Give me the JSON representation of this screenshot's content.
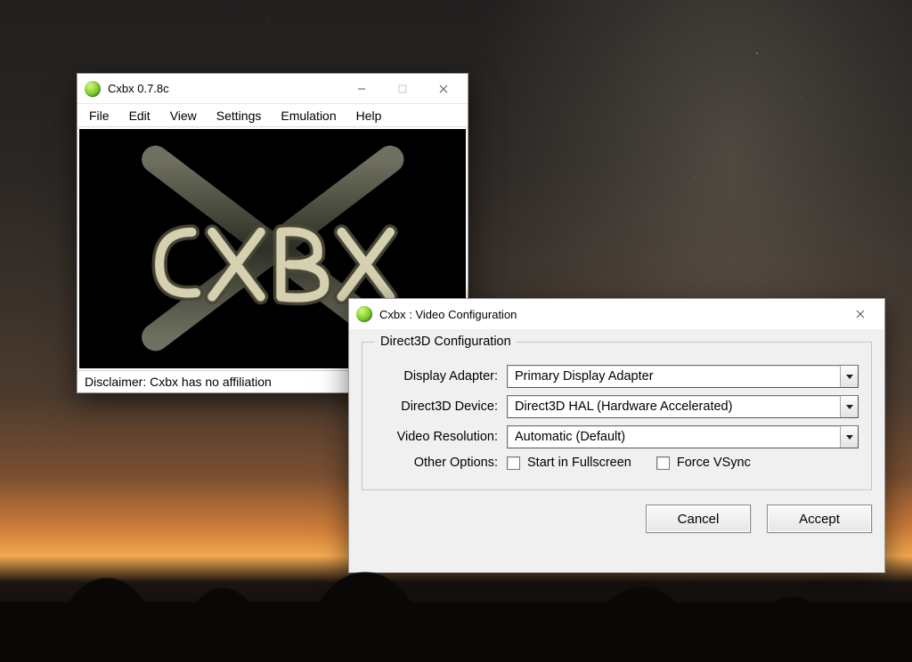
{
  "main_window": {
    "title": "Cxbx 0.7.8c",
    "menu": {
      "file": "File",
      "edit": "Edit",
      "view": "View",
      "settings": "Settings",
      "emulation": "Emulation",
      "help": "Help"
    },
    "logo_text": "CXBX",
    "statusbar": "Disclaimer: Cxbx has no affiliation"
  },
  "dialog": {
    "title": "Cxbx : Video Configuration",
    "group_caption": "Direct3D Configuration",
    "labels": {
      "display_adapter": "Display Adapter:",
      "d3d_device": "Direct3D Device:",
      "video_res": "Video Resolution:",
      "other_options": "Other Options:"
    },
    "values": {
      "display_adapter": "Primary Display Adapter",
      "d3d_device": "Direct3D HAL (Hardware Accelerated)",
      "video_res": "Automatic (Default)"
    },
    "checkboxes": {
      "fullscreen_label": "Start in Fullscreen",
      "fullscreen_checked": false,
      "vsync_label": "Force VSync",
      "vsync_checked": false
    },
    "buttons": {
      "cancel": "Cancel",
      "accept": "Accept"
    }
  }
}
